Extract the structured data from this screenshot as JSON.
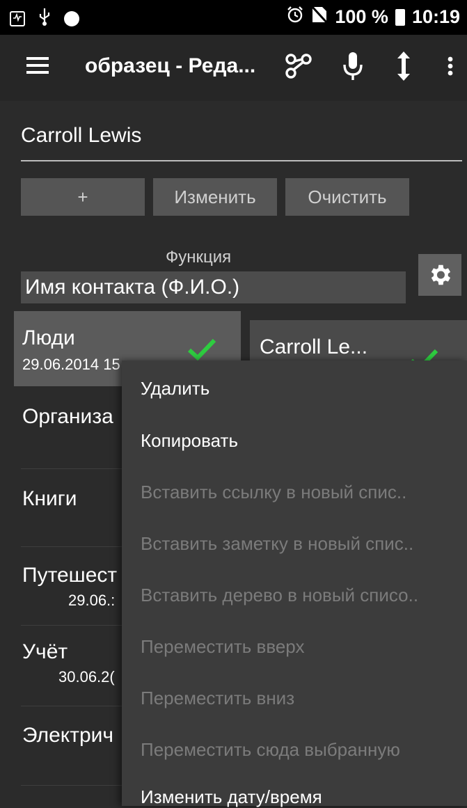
{
  "status_bar": {
    "battery_percent": "100 %",
    "time": "10:19",
    "icons": [
      "activity-icon",
      "usb-icon",
      "circle-icon",
      "alarm-icon",
      "no-sim-icon",
      "battery-icon"
    ]
  },
  "toolbar": {
    "title": "образец - Реда...",
    "icons": [
      "menu-icon",
      "share-nodes-icon",
      "microphone-icon",
      "resize-vertical-icon",
      "more-icon"
    ]
  },
  "editor": {
    "contact_name": "Carroll Lewis",
    "buttons": {
      "add": "+",
      "edit": "Изменить",
      "clear": "Очистить"
    },
    "function_label": "Функция",
    "function_value": "Имя контакта (Ф.И.О.)"
  },
  "list": {
    "items": [
      {
        "title": "Люди",
        "date": "29.06.2014 15"
      },
      {
        "title": "Организа",
        "date": ""
      },
      {
        "title": "Книги",
        "date": ""
      },
      {
        "title": "Путешест",
        "date": "29.06.:"
      },
      {
        "title": "Учёт",
        "date": "30.06.2("
      },
      {
        "title": "Электрич",
        "date": ""
      }
    ],
    "selected_card": "Carroll Le..."
  },
  "context_menu": {
    "items": [
      {
        "label": "Удалить",
        "enabled": true
      },
      {
        "label": "Копировать",
        "enabled": true
      },
      {
        "label": "Вставить ссылку в новый спис..",
        "enabled": false
      },
      {
        "label": "Вставить заметку в новый спис..",
        "enabled": false
      },
      {
        "label": "Вставить дерево в новый списо..",
        "enabled": false
      },
      {
        "label": "Переместить вверх",
        "enabled": false
      },
      {
        "label": "Переместить вниз",
        "enabled": false
      },
      {
        "label": "Переместить сюда выбранную",
        "enabled": false
      },
      {
        "label": "Изменить дату/время",
        "enabled": true
      }
    ]
  },
  "colors": {
    "check": "#2ecc40",
    "background": "#2b2b2b",
    "menu_bg": "#3c3c3c"
  }
}
